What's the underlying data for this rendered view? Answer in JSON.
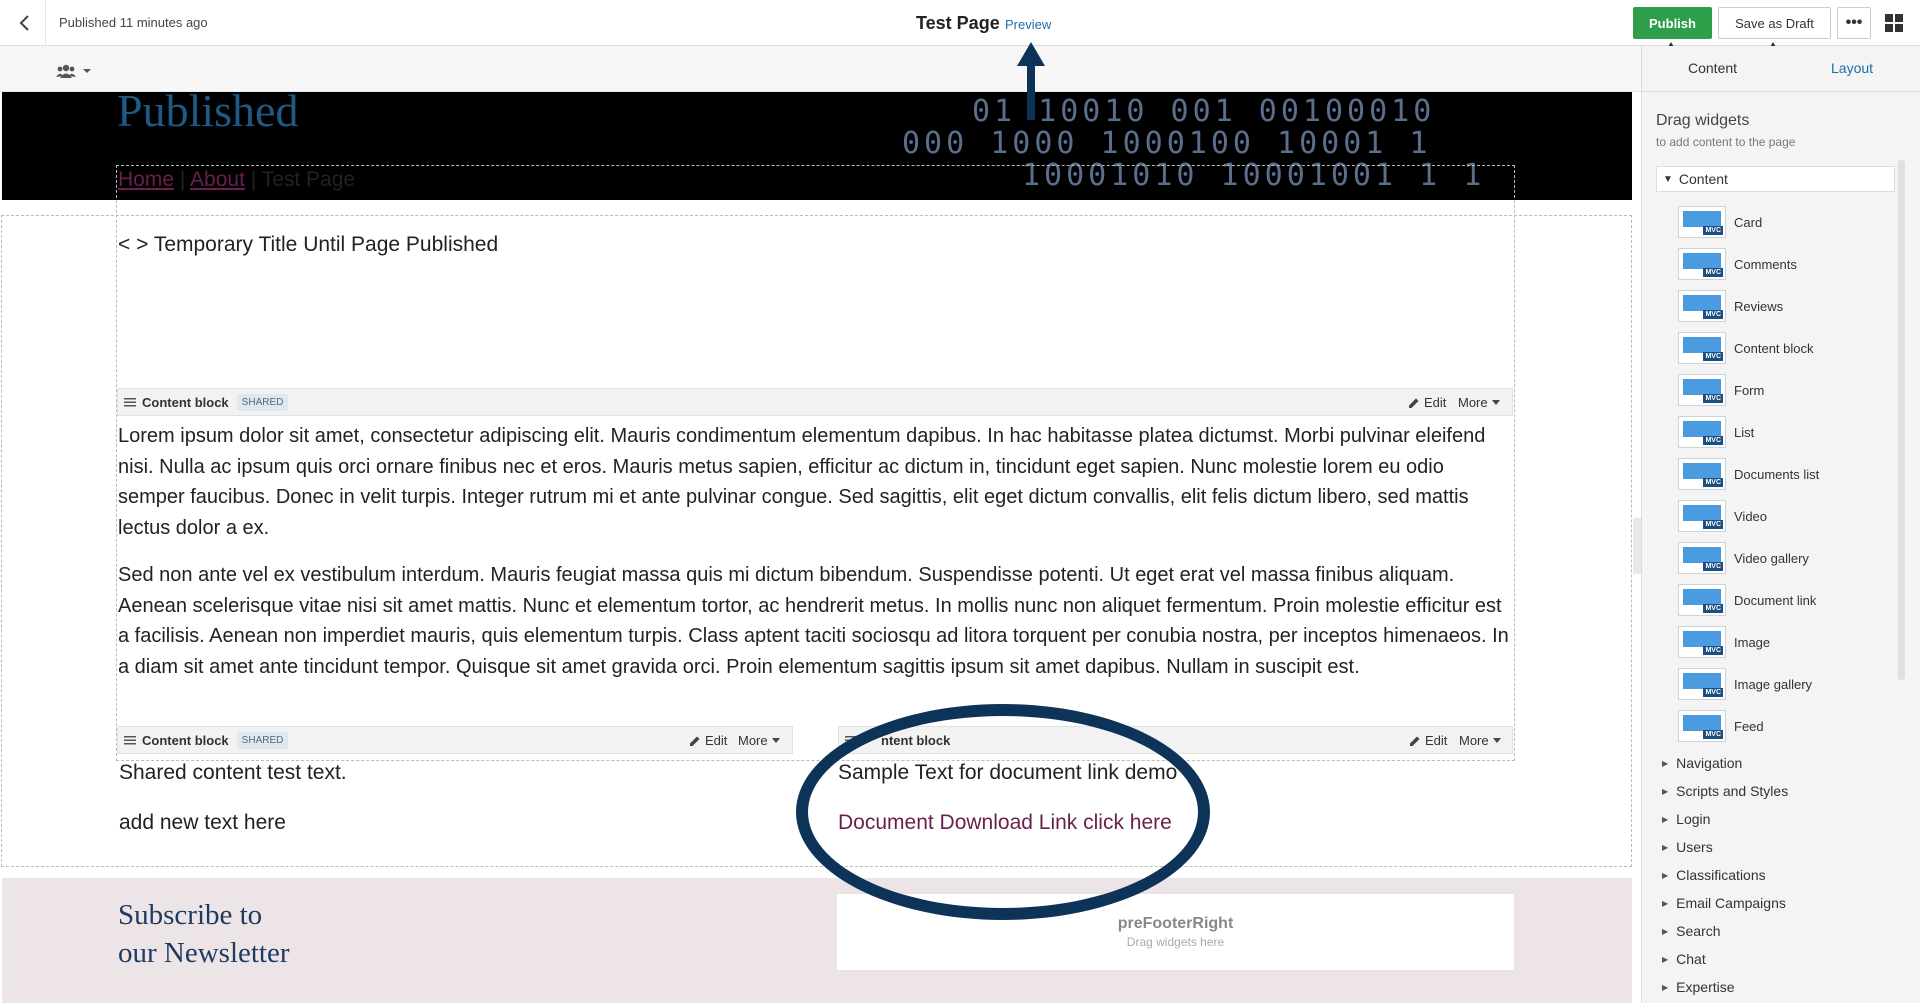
{
  "topbar": {
    "published_status": "Published 11 minutes ago",
    "page_title": "Test Page",
    "preview_label": "Preview",
    "publish_label": "Publish",
    "save_draft_label": "Save as Draft",
    "more_label": "•••"
  },
  "canvas": {
    "banner_title": "Published",
    "banner_binary": [
      "01 10010 001 00100010",
      "000 1000 1000100 10001 1",
      "10001010 10001001 1 1"
    ],
    "breadcrumb": {
      "home": "Home",
      "separator1": "|",
      "about": "About",
      "separator2": "|",
      "current": "Test Page"
    },
    "temp_title": "< > Temporary Title Until Page Published",
    "content_block_main": {
      "label": "Content block",
      "badge": "SHARED",
      "edit": "Edit",
      "more": "More",
      "paragraph1": "Lorem ipsum dolor sit amet, consectetur adipiscing elit. Mauris condimentum elementum dapibus. In hac habitasse platea dictumst. Morbi pulvinar eleifend nisi. Nulla ac ipsum quis orci ornare finibus nec et eros. Mauris metus sapien, efficitur ac dictum in, tincidunt eget sapien. Nunc molestie lorem eu odio semper faucibus. Donec in velit turpis. Integer rutrum mi et ante pulvinar congue. Sed sagittis, elit eget dictum convallis, elit felis dictum libero, sed mattis lectus dolor a ex.",
      "paragraph2": "Sed non ante vel ex vestibulum interdum. Mauris feugiat massa quis mi dictum bibendum. Suspendisse potenti. Ut eget erat vel massa finibus aliquam. Aenean scelerisque vitae nisi sit amet mattis. Nunc et elementum tortor, ac hendrerit metus. In mollis nunc non aliquet fermentum. Proin molestie efficitur est a facilisis. Aenean non imperdiet mauris, quis elementum turpis. Class aptent taciti sociosqu ad litora torquent per conubia nostra, per inceptos himenaeos. In a diam sit amet ante tincidunt tempor. Quisque sit amet gravida orci. Proin elementum sagittis ipsum sit amet dapibus. Nullam in suscipit est."
    },
    "content_block_left": {
      "label": "Content block",
      "badge": "SHARED",
      "edit": "Edit",
      "more": "More",
      "line1": "Shared content test text.",
      "line2": "add new text here"
    },
    "content_block_right": {
      "label": "ntent block",
      "edit": "Edit",
      "more": "More",
      "line1": "Sample Text for document link demo",
      "link": "Document Download Link click here"
    },
    "prefooter": {
      "subscribe_line1": "Subscribe to",
      "subscribe_line2": "our Newsletter",
      "right_title": "preFooterRight",
      "right_sub": "Drag widgets here"
    }
  },
  "sidebar": {
    "tab_content": "Content",
    "tab_layout": "Layout",
    "drag_title": "Drag widgets",
    "drag_sub": "to add content to the page",
    "group_label": "Content",
    "widgets": [
      {
        "label": "Card",
        "icon": "card-widget-icon"
      },
      {
        "label": "Comments",
        "icon": "comments-widget-icon"
      },
      {
        "label": "Reviews",
        "icon": "reviews-widget-icon"
      },
      {
        "label": "Content block",
        "icon": "content-block-widget-icon"
      },
      {
        "label": "Form",
        "icon": "form-widget-icon"
      },
      {
        "label": "List",
        "icon": "list-widget-icon"
      },
      {
        "label": "Documents list",
        "icon": "documents-list-widget-icon"
      },
      {
        "label": "Video",
        "icon": "video-widget-icon"
      },
      {
        "label": "Video gallery",
        "icon": "video-gallery-widget-icon"
      },
      {
        "label": "Document link",
        "icon": "document-link-widget-icon"
      },
      {
        "label": "Image",
        "icon": "image-widget-icon"
      },
      {
        "label": "Image gallery",
        "icon": "image-gallery-widget-icon"
      },
      {
        "label": "Feed",
        "icon": "feed-widget-icon"
      }
    ],
    "mvc_badge": "MVC",
    "categories": [
      "Navigation",
      "Scripts and Styles",
      "Login",
      "Users",
      "Classifications",
      "Email Campaigns",
      "Search",
      "Chat",
      "Expertise"
    ]
  },
  "colors": {
    "publish_green": "#2e9e4a",
    "link_blue": "#1e6ea7",
    "link_maroon": "#6b1f4e",
    "annotation_navy": "#0e3358",
    "prefooter_bg": "#ede4e8"
  }
}
